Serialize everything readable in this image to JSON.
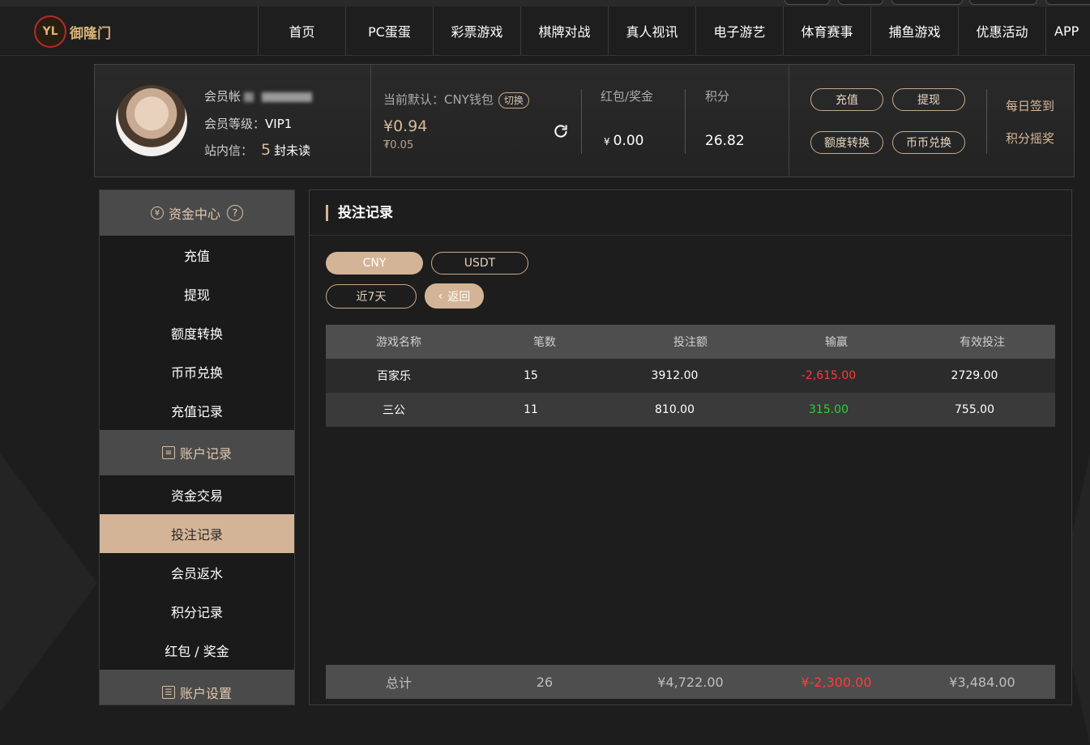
{
  "brand": {
    "logo_text": "御隆门"
  },
  "nav": [
    "首页",
    "PC蛋蛋",
    "彩票游戏",
    "棋牌对战",
    "真人视讯",
    "电子游艺",
    "体育赛事",
    "捕鱼游戏",
    "优惠活动",
    "APP"
  ],
  "user": {
    "account_label": "会员帐",
    "level_label": "会员等级：",
    "level_value": "VIP1",
    "inbox_label": "站内信：",
    "inbox_count": "5",
    "inbox_suffix": "封未读"
  },
  "wallet": {
    "label": "当前默认：CNY钱包",
    "switch": "切换",
    "amount": "¥0.94",
    "sub_amount": "₮0.05"
  },
  "bonus": {
    "label": "红包/奖金",
    "currency": "¥",
    "value": "0.00"
  },
  "points": {
    "label": "积分",
    "value": "26.82"
  },
  "actions": {
    "deposit": "充值",
    "withdraw": "提现",
    "transfer": "额度转换",
    "exchange": "币币兑换"
  },
  "side_links": {
    "checkin": "每日签到",
    "lottery": "积分摇奖"
  },
  "sidebar": {
    "fund_center": "资金中心",
    "fund_items": [
      "充值",
      "提现",
      "额度转换",
      "币币兑换",
      "充值记录"
    ],
    "account_records": "账户记录",
    "record_items": [
      "资金交易",
      "投注记录",
      "会员返水",
      "积分记录",
      "红包 / 奖金"
    ],
    "account_settings": "账户设置"
  },
  "main": {
    "title": "投注记录",
    "currency_tabs": [
      "CNY",
      "USDT"
    ],
    "range": "近7天",
    "back": "返回",
    "columns": [
      "游戏名称",
      "笔数",
      "投注额",
      "输赢",
      "有效投注"
    ],
    "rows": [
      {
        "game": "百家乐",
        "count": "15",
        "amount": "3912.00",
        "result": "-2,615.00",
        "valid": "2729.00"
      },
      {
        "game": "三公",
        "count": "11",
        "amount": "810.00",
        "result": "315.00",
        "valid": "755.00"
      }
    ],
    "total": {
      "label": "总计",
      "count": "26",
      "amount": "¥4,722.00",
      "result": "¥-2,300.00",
      "valid": "¥3,484.00"
    }
  },
  "colors": {
    "accent": "#d4b496",
    "negative": "#ff3b3b",
    "positive": "#2bd13b"
  }
}
